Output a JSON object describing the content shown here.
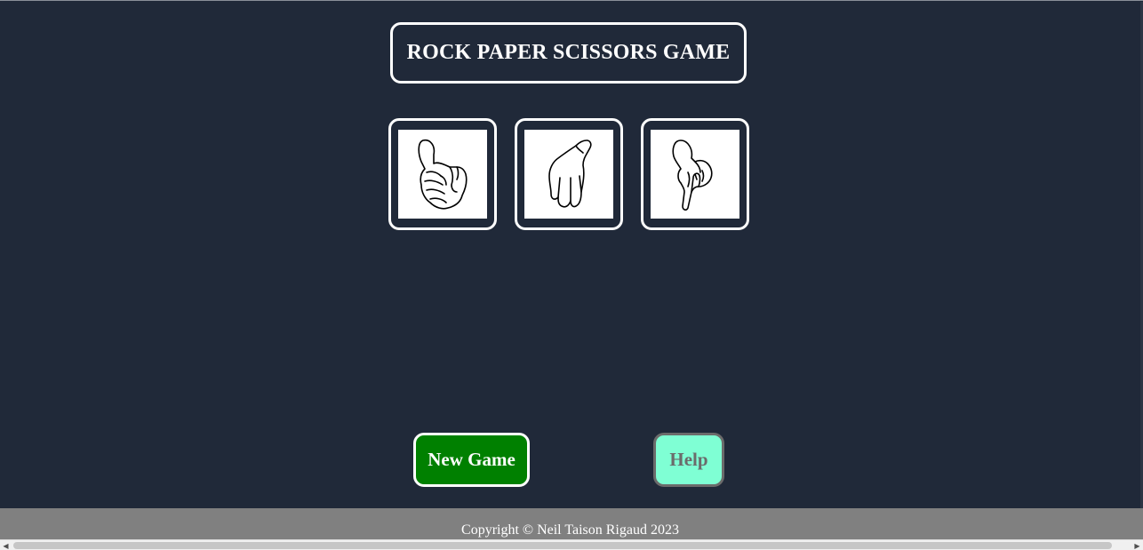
{
  "header": {
    "title": "ROCK PAPER SCISSORS GAME"
  },
  "choices": [
    {
      "name": "rock",
      "icon": "rock-hand-icon"
    },
    {
      "name": "paper",
      "icon": "paper-hand-icon"
    },
    {
      "name": "scissors",
      "icon": "scissors-hand-icon"
    }
  ],
  "buttons": {
    "new_game_label": "New Game",
    "help_label": "Help"
  },
  "footer": {
    "copyright": "Copyright © Neil Taison Rigaud 2023"
  },
  "colors": {
    "background": "#202939",
    "new_game_bg": "#008000",
    "help_bg": "#7fffd4",
    "footer_bg": "#808080"
  }
}
